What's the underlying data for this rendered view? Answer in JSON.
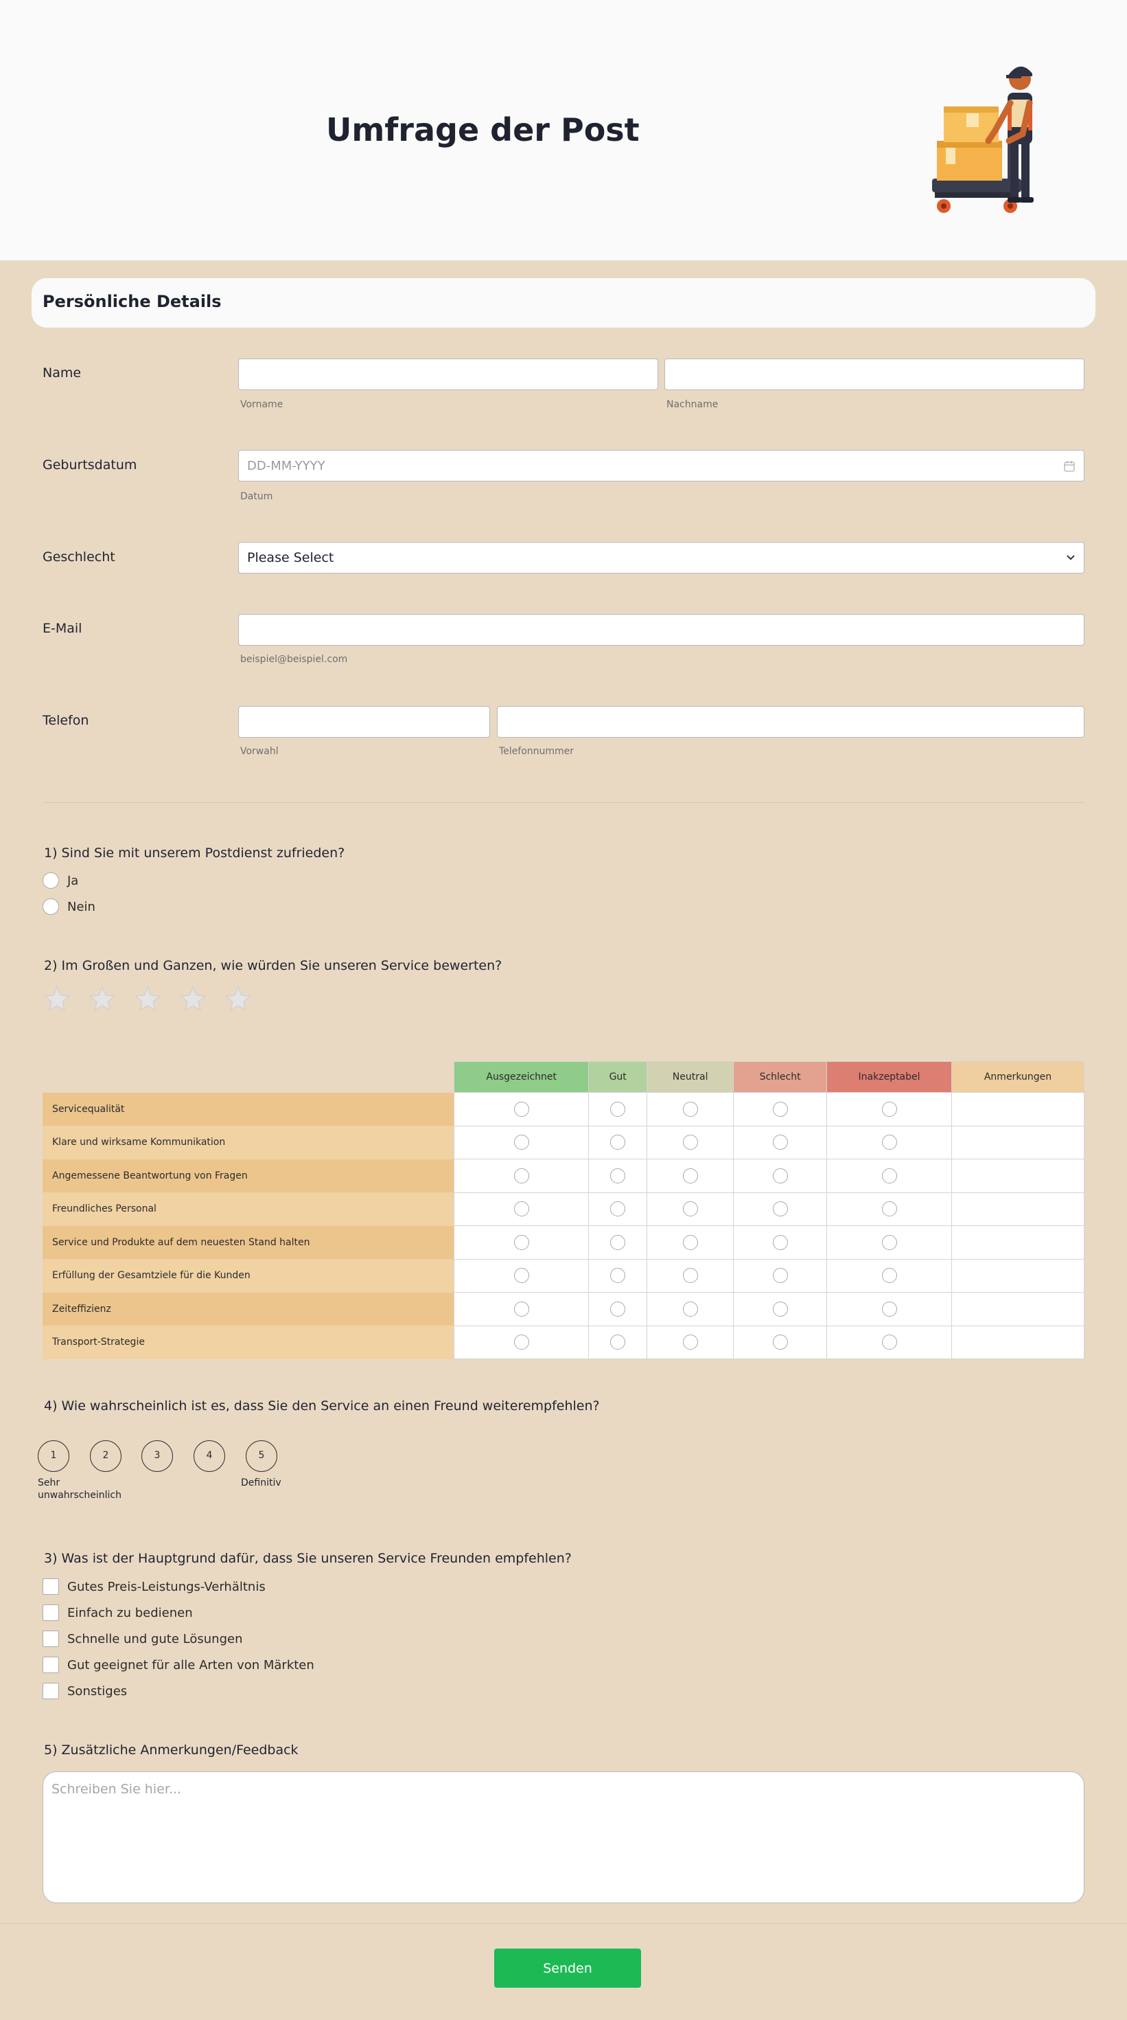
{
  "header": {
    "title": "Umfrage der Post"
  },
  "section": {
    "title": "Persönliche Details"
  },
  "fields": {
    "name": {
      "label": "Name",
      "first_sub": "Vorname",
      "last_sub": "Nachname"
    },
    "birthdate": {
      "label": "Geburtsdatum",
      "placeholder": "DD-MM-YYYY",
      "sub": "Datum"
    },
    "gender": {
      "label": "Geschlecht",
      "value": "Please Select"
    },
    "email": {
      "label": "E-Mail",
      "sub": "beispiel@beispiel.com"
    },
    "phone": {
      "label": "Telefon",
      "area_sub": "Vorwahl",
      "number_sub": "Telefonnummer"
    }
  },
  "q1": {
    "text": "1) Sind Sie mit unserem Postdienst zufrieden?",
    "options": [
      "Ja",
      "Nein"
    ]
  },
  "q2": {
    "text": "2) Im Großen und Ganzen, wie würden Sie unseren Service bewerten?",
    "stars_total": 5,
    "stars_selected": 0
  },
  "matrix": {
    "columns": [
      {
        "label": "Ausgezeichnet",
        "color": "#8fcb89"
      },
      {
        "label": "Gut",
        "color": "#b1d19e"
      },
      {
        "label": "Neutral",
        "color": "#d2d1b2"
      },
      {
        "label": "Schlecht",
        "color": "#e3a28f"
      },
      {
        "label": "Inakzeptabel",
        "color": "#dd7e72"
      },
      {
        "label": "Anmerkungen",
        "color": "#efcf9f"
      }
    ],
    "rows": [
      "Servicequalität",
      "Klare und wirksame Kommunikation",
      "Angemessene Beantwortung von Fragen",
      "Freundliches Personal",
      "Service und Produkte auf dem neuesten Stand halten",
      "Erfüllung der Gesamtziele für die Kunden",
      "Zeiteffizienz",
      "Transport-Strategie"
    ],
    "row_colors": [
      "#ecc58d",
      "#f0d2a3"
    ]
  },
  "q4": {
    "text": "4) Wie wahrscheinlich ist es, dass Sie den Service an einen Freund weiterempfehlen?",
    "options": [
      "1",
      "2",
      "3",
      "4",
      "5"
    ],
    "low_label_1": "Sehr",
    "low_label_2": "unwahrscheinlich",
    "high_label": "Definitiv"
  },
  "q3": {
    "text": "3) Was ist der Hauptgrund dafür, dass Sie unseren Service Freunden empfehlen?",
    "options": [
      "Gutes Preis-Leistungs-Verhältnis",
      "Einfach zu bedienen",
      "Schnelle und gute Lösungen",
      "Gut geeignet für alle Arten von Märkten",
      "Sonstiges"
    ]
  },
  "q5": {
    "text": "5) Zusätzliche Anmerkungen/Feedback",
    "placeholder": "Schreiben Sie hier..."
  },
  "submit": {
    "label": "Senden"
  }
}
